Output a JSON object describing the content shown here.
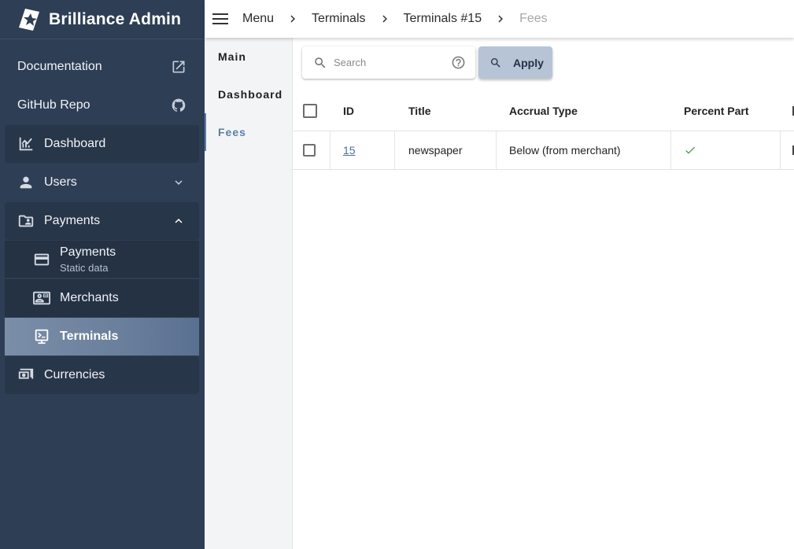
{
  "brand": {
    "title": "Brilliance Admin"
  },
  "sidebar": {
    "items": [
      {
        "label": "Documentation",
        "icon": "external-link-icon"
      },
      {
        "label": "GitHub Repo",
        "icon": "github-icon"
      },
      {
        "label": "Dashboard",
        "icon": "chart-icon"
      },
      {
        "label": "Users",
        "icon": "person-icon",
        "trail": "chevron-down-icon"
      },
      {
        "label": "Payments",
        "icon": "folder-shared-icon",
        "trail": "chevron-up-icon"
      },
      {
        "label": "Payments",
        "sublabel": "Static data",
        "icon": "credit-card-icon"
      },
      {
        "label": "Merchants",
        "icon": "contact-card-icon"
      },
      {
        "label": "Terminals",
        "icon": "terminal-icon",
        "active": true
      },
      {
        "label": "Currencies",
        "icon": "money-icon"
      }
    ]
  },
  "breadcrumb": [
    "Menu",
    "Terminals",
    "Terminals #15",
    "Fees"
  ],
  "tabs": [
    {
      "label": "Main"
    },
    {
      "label": "Dashboard"
    },
    {
      "label": "Fees",
      "active": true
    }
  ],
  "search": {
    "placeholder": "Search",
    "apply_label": "Apply"
  },
  "table": {
    "columns": [
      "ID",
      "Title",
      "Accrual Type",
      "Percent Part"
    ],
    "rows": [
      {
        "id": "15",
        "title": "newspaper",
        "accrual_type": "Below (from merchant)",
        "percent_part": true
      }
    ]
  },
  "colors": {
    "sidebar_bg": "#2e3e55",
    "accent": "#5d7ea5",
    "check_green": "#43a047"
  }
}
